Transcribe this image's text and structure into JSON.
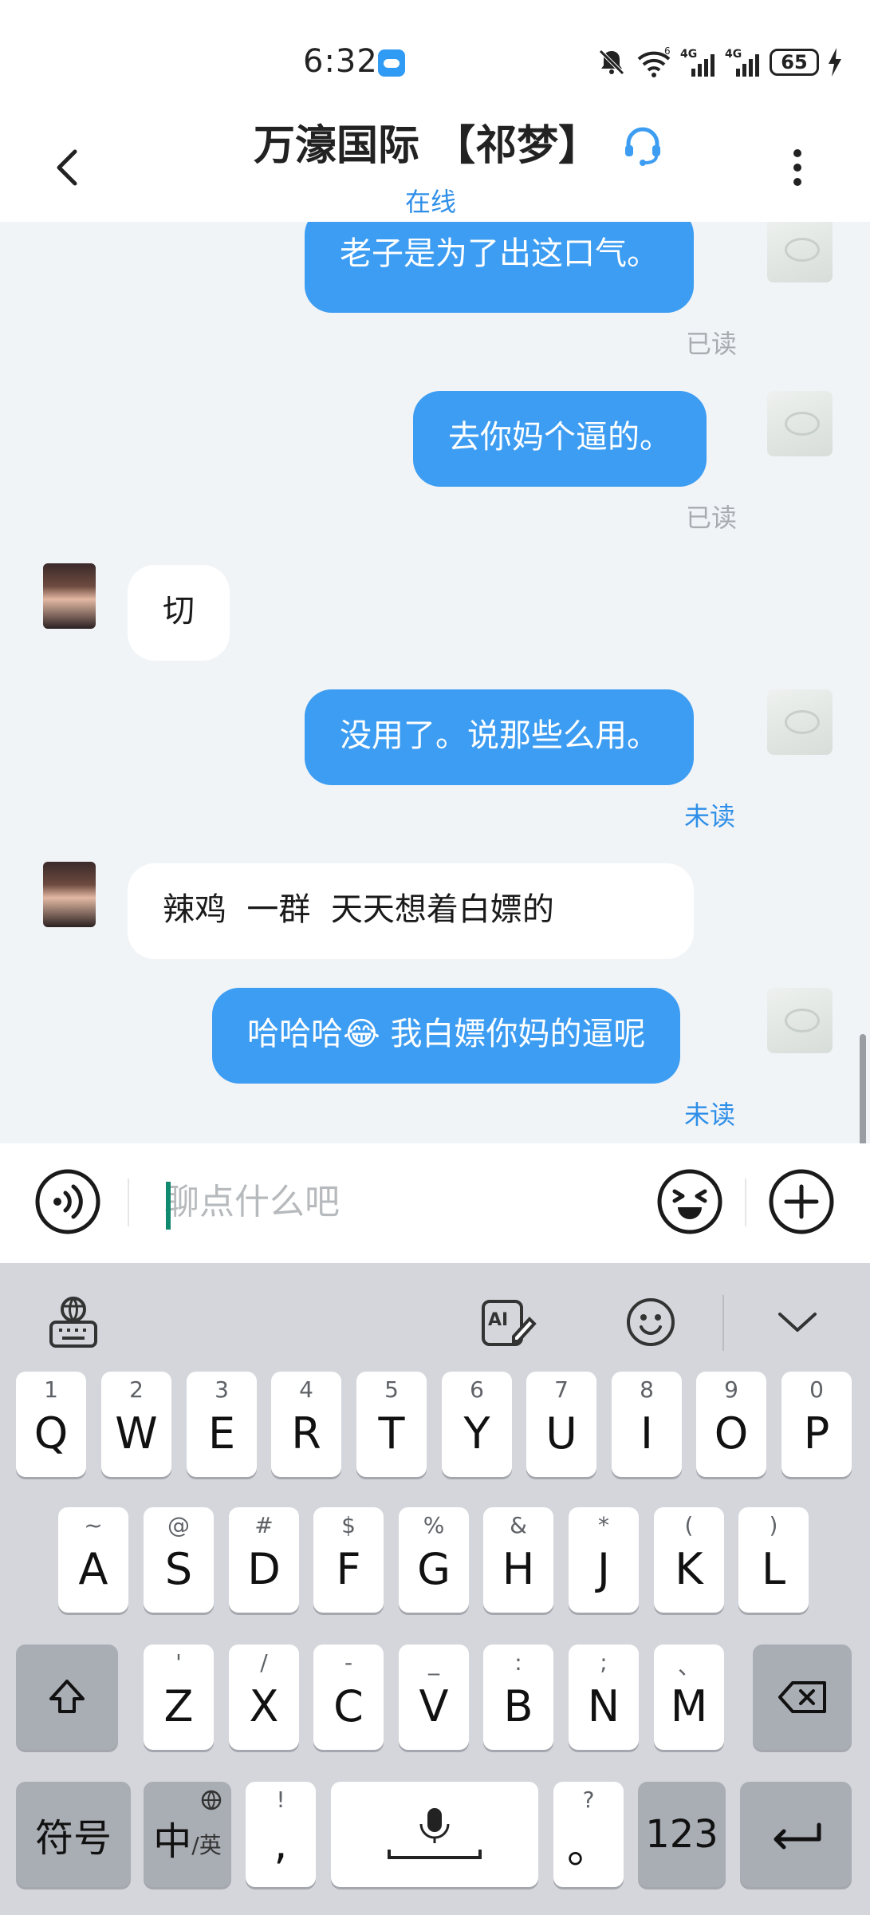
{
  "status_bar": {
    "time": "6:32",
    "battery": "65",
    "signal1": "4G",
    "signal2": "4G",
    "wifi_badge": "6"
  },
  "header": {
    "title": "万濠国际 【祁梦】",
    "status": "在线"
  },
  "messages": [
    {
      "dir": "out",
      "text": "老子是为了出这口气。",
      "receipt": "已读"
    },
    {
      "dir": "out",
      "text": "去你妈个逼的。",
      "receipt": "已读"
    },
    {
      "dir": "in",
      "text": "切"
    },
    {
      "dir": "out",
      "text": "没用了。说那些么用。",
      "receipt": "未读"
    },
    {
      "dir": "in",
      "text": "辣鸡  一群  天天想着白嫖的"
    },
    {
      "dir": "out",
      "text": "哈哈哈😂 我白嫖你妈的逼呢",
      "receipt": "未读"
    }
  ],
  "input": {
    "placeholder": "聊点什么吧"
  },
  "keyboard": {
    "row1": [
      {
        "k": "Q",
        "s": "1"
      },
      {
        "k": "W",
        "s": "2"
      },
      {
        "k": "E",
        "s": "3"
      },
      {
        "k": "R",
        "s": "4"
      },
      {
        "k": "T",
        "s": "5"
      },
      {
        "k": "Y",
        "s": "6"
      },
      {
        "k": "U",
        "s": "7"
      },
      {
        "k": "I",
        "s": "8"
      },
      {
        "k": "O",
        "s": "9"
      },
      {
        "k": "P",
        "s": "0"
      }
    ],
    "row2": [
      {
        "k": "A",
        "s": "~"
      },
      {
        "k": "S",
        "s": "@"
      },
      {
        "k": "D",
        "s": "#"
      },
      {
        "k": "F",
        "s": "$"
      },
      {
        "k": "G",
        "s": "%"
      },
      {
        "k": "H",
        "s": "&"
      },
      {
        "k": "J",
        "s": "*"
      },
      {
        "k": "K",
        "s": "("
      },
      {
        "k": "L",
        "s": ")"
      }
    ],
    "row3": [
      {
        "k": "Z",
        "s": "'"
      },
      {
        "k": "X",
        "s": "/"
      },
      {
        "k": "C",
        "s": "-"
      },
      {
        "k": "V",
        "s": "_"
      },
      {
        "k": "B",
        "s": ":"
      },
      {
        "k": "N",
        "s": ";"
      },
      {
        "k": "M",
        "s": "、"
      }
    ],
    "symbols_label": "符号",
    "lang_main": "中",
    "lang_sub": "/英",
    "comma": ",",
    "comma_sub": "!",
    "period": "。",
    "period_sub": "?",
    "numbers_label": "123"
  }
}
